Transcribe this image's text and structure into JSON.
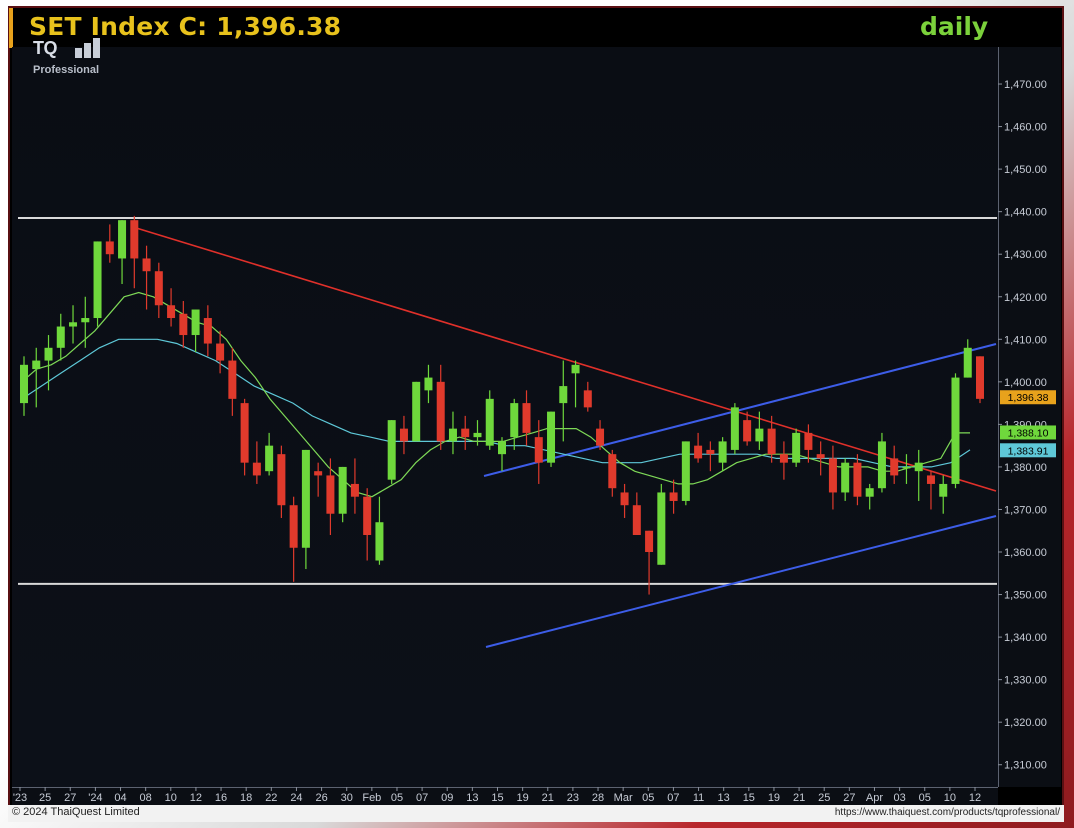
{
  "header": {
    "title": "SET Index C: 1,396.38",
    "period": "daily",
    "logo_text": "TQ",
    "logo_subtext": "Professional"
  },
  "footer": {
    "copyright": "© 2024 ThaiQuest Limited",
    "url": "https://www.thaiquest.com/products/tqprofessional/"
  },
  "colors": {
    "up": "#6fd83c",
    "down": "#e03a2c",
    "ma_fast": "#7ed957",
    "ma_slow": "#5ec8d8",
    "trendline_down": "#e0302a",
    "channel": "#3d5de8",
    "horizontal": "#d9d9d9"
  },
  "chart_data": {
    "type": "candlestick",
    "ylim": [
      1305,
      1478
    ],
    "yticks": [
      "1,310.00",
      "1,320.00",
      "1,330.00",
      "1,340.00",
      "1,350.00",
      "1,360.00",
      "1,370.00",
      "1,380.00",
      "1,390.00",
      "1,400.00",
      "1,410.00",
      "1,420.00",
      "1,430.00",
      "1,440.00",
      "1,450.00",
      "1,460.00",
      "1,470.00"
    ],
    "xticks": [
      "'23",
      "25",
      "27",
      "'24",
      "04",
      "08",
      "10",
      "12",
      "16",
      "18",
      "22",
      "24",
      "26",
      "30",
      "Feb",
      "05",
      "07",
      "09",
      "13",
      "15",
      "19",
      "21",
      "23",
      "28",
      "Mar",
      "05",
      "07",
      "11",
      "13",
      "15",
      "19",
      "21",
      "25",
      "27",
      "Apr",
      "03",
      "05",
      "10",
      "12"
    ],
    "price_labels": [
      {
        "label": "1,396.38",
        "value": 1396.38,
        "color": "#e8a21c"
      },
      {
        "label": "1,388.10",
        "value": 1388.1,
        "color": "#6fd83c"
      },
      {
        "label": "1,383.91",
        "value": 1383.91,
        "color": "#5ec8d8"
      }
    ],
    "candles": [
      [
        1395,
        1406,
        1392,
        1404
      ],
      [
        1403,
        1408,
        1394,
        1405
      ],
      [
        1405,
        1411,
        1398,
        1408
      ],
      [
        1408,
        1416,
        1405,
        1413
      ],
      [
        1413,
        1418,
        1409,
        1414
      ],
      [
        1414,
        1420,
        1408,
        1415
      ],
      [
        1415,
        1433,
        1413,
        1433
      ],
      [
        1433,
        1437,
        1428,
        1430
      ],
      [
        1429,
        1437,
        1423,
        1438
      ],
      [
        1438,
        1439,
        1422,
        1429
      ],
      [
        1429,
        1432,
        1417,
        1426
      ],
      [
        1426,
        1428,
        1415,
        1418
      ],
      [
        1418,
        1422,
        1413,
        1415
      ],
      [
        1416,
        1419,
        1408,
        1411
      ],
      [
        1411,
        1416,
        1407,
        1417
      ],
      [
        1415,
        1418,
        1406,
        1409
      ],
      [
        1409,
        1412,
        1402,
        1405
      ],
      [
        1405,
        1408,
        1392,
        1396
      ],
      [
        1395,
        1396,
        1378,
        1381
      ],
      [
        1381,
        1386,
        1376,
        1378
      ],
      [
        1379,
        1388,
        1378,
        1385
      ],
      [
        1383,
        1385,
        1368,
        1371
      ],
      [
        1371,
        1373,
        1353,
        1361
      ],
      [
        1361,
        1383,
        1356,
        1384
      ],
      [
        1379,
        1381,
        1373,
        1378
      ],
      [
        1378,
        1382,
        1364,
        1369
      ],
      [
        1369,
        1379,
        1367,
        1380
      ],
      [
        1376,
        1382,
        1369,
        1373
      ],
      [
        1373,
        1375,
        1358,
        1364
      ],
      [
        1358,
        1373,
        1357,
        1367
      ],
      [
        1377,
        1391,
        1376,
        1391
      ],
      [
        1389,
        1392,
        1383,
        1386
      ],
      [
        1386,
        1400,
        1386,
        1400
      ],
      [
        1398,
        1404,
        1395,
        1401
      ],
      [
        1400,
        1404,
        1384,
        1386
      ],
      [
        1386,
        1393,
        1383,
        1389
      ],
      [
        1389,
        1392,
        1384,
        1387
      ],
      [
        1387,
        1391,
        1385,
        1388
      ],
      [
        1385,
        1398,
        1384,
        1396
      ],
      [
        1383,
        1387,
        1379,
        1386
      ],
      [
        1387,
        1396,
        1384,
        1395
      ],
      [
        1395,
        1398,
        1385,
        1388
      ],
      [
        1387,
        1391,
        1376,
        1381
      ],
      [
        1381,
        1393,
        1380,
        1393
      ],
      [
        1395,
        1405,
        1386,
        1399
      ],
      [
        1402,
        1405,
        1394,
        1404
      ],
      [
        1398,
        1400,
        1393,
        1394
      ],
      [
        1389,
        1391,
        1384,
        1385
      ],
      [
        1383,
        1384,
        1373,
        1375
      ],
      [
        1374,
        1376,
        1368,
        1371
      ],
      [
        1371,
        1374,
        1365,
        1364
      ],
      [
        1365,
        1362,
        1350,
        1360
      ],
      [
        1357,
        1376,
        1357,
        1374
      ],
      [
        1374,
        1377,
        1369,
        1372
      ],
      [
        1372,
        1386,
        1371,
        1386
      ],
      [
        1385,
        1388,
        1381,
        1382
      ],
      [
        1384,
        1386,
        1379,
        1383
      ],
      [
        1381,
        1387,
        1379,
        1386
      ],
      [
        1384,
        1395,
        1383,
        1394
      ],
      [
        1391,
        1393,
        1385,
        1386
      ],
      [
        1386,
        1393,
        1384,
        1389
      ],
      [
        1389,
        1392,
        1381,
        1383
      ],
      [
        1383,
        1386,
        1377,
        1381
      ],
      [
        1381,
        1389,
        1380,
        1388
      ],
      [
        1388,
        1390,
        1381,
        1384
      ],
      [
        1383,
        1386,
        1378,
        1382
      ],
      [
        1382,
        1385,
        1370,
        1374
      ],
      [
        1374,
        1382,
        1372,
        1381
      ],
      [
        1381,
        1383,
        1371,
        1373
      ],
      [
        1373,
        1376,
        1370,
        1375
      ],
      [
        1375,
        1388,
        1374,
        1386
      ],
      [
        1382,
        1385,
        1376,
        1378
      ],
      [
        1380,
        1383,
        1376,
        1380
      ],
      [
        1379,
        1384,
        1372,
        1381
      ],
      [
        1378,
        1379,
        1370,
        1376
      ],
      [
        1373,
        1378,
        1369,
        1376
      ],
      [
        1376,
        1402,
        1375,
        1401
      ],
      [
        1401,
        1410,
        1404,
        1408
      ],
      [
        1406,
        1406,
        1395,
        1396
      ]
    ],
    "ma_fast": [
      1400,
      1403,
      1404,
      1406,
      1409,
      1412,
      1416,
      1420,
      1421,
      1420,
      1418,
      1416,
      1414,
      1413,
      1410,
      1405,
      1401,
      1396,
      1392,
      1388,
      1384,
      1380,
      1377,
      1374,
      1373,
      1375,
      1377,
      1381,
      1384,
      1386,
      1387,
      1386,
      1386,
      1386,
      1387,
      1388,
      1389,
      1389,
      1389,
      1387,
      1384,
      1381,
      1379,
      1378,
      1377,
      1376,
      1376,
      1377,
      1379,
      1381,
      1382,
      1383,
      1383,
      1383,
      1382,
      1381,
      1380,
      1380,
      1380,
      1379,
      1379,
      1380,
      1381,
      1382,
      1388,
      1388
    ],
    "ma_slow": [
      1396,
      1399,
      1402,
      1405,
      1408,
      1410,
      1410,
      1410,
      1409,
      1407,
      1405,
      1402,
      1399,
      1397,
      1395,
      1392,
      1390,
      1388,
      1387,
      1386,
      1386,
      1386,
      1386,
      1386,
      1386,
      1385,
      1385,
      1384,
      1383,
      1382,
      1381,
      1381,
      1381,
      1382,
      1383,
      1383,
      1383,
      1383,
      1383,
      1382,
      1382,
      1382,
      1382,
      1382,
      1381,
      1380,
      1380,
      1380,
      1381,
      1384
    ],
    "lines": [
      {
        "name": "resistance",
        "from": [
          0,
          1438.5
        ],
        "to": [
          1,
          1438.5
        ]
      },
      {
        "name": "support",
        "from": [
          0,
          1352.5
        ],
        "to": [
          1,
          1352.5
        ]
      }
    ]
  }
}
